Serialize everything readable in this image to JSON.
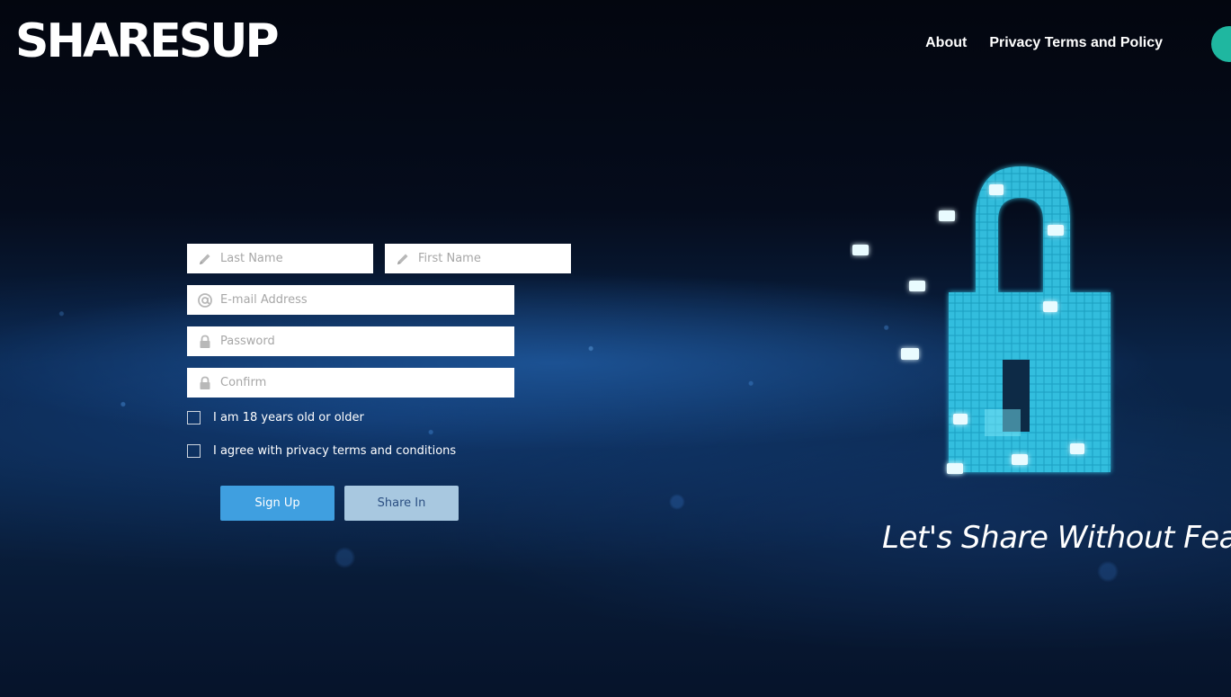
{
  "header": {
    "logo": "SHARESUP",
    "nav": [
      {
        "label": "About"
      },
      {
        "label": "Privacy Terms and Policy"
      }
    ]
  },
  "form": {
    "last_name": {
      "placeholder": "Last Name",
      "value": ""
    },
    "first_name": {
      "placeholder": "First Name",
      "value": ""
    },
    "email": {
      "placeholder": "E-mail Address",
      "value": ""
    },
    "password": {
      "placeholder": "Password",
      "value": ""
    },
    "confirm": {
      "placeholder": "Confirm",
      "value": ""
    },
    "checkbox_age": {
      "label": "I am 18 years old or older",
      "checked": false
    },
    "checkbox_terms": {
      "label": "I agree with privacy terms and conditions",
      "checked": false
    },
    "signup_label": "Sign Up",
    "sharein_label": "Share In"
  },
  "hero": {
    "tagline": "Let's Share Without Fear"
  },
  "colors": {
    "primary_button": "#3f9fe0",
    "secondary_button": "#a8c8e0",
    "accent_cyan": "#2fd0f0",
    "avatar": "#1fb7a0"
  },
  "icons": {
    "name_field": "pencil-icon",
    "email_field": "at-icon",
    "password_field": "lock-icon"
  }
}
